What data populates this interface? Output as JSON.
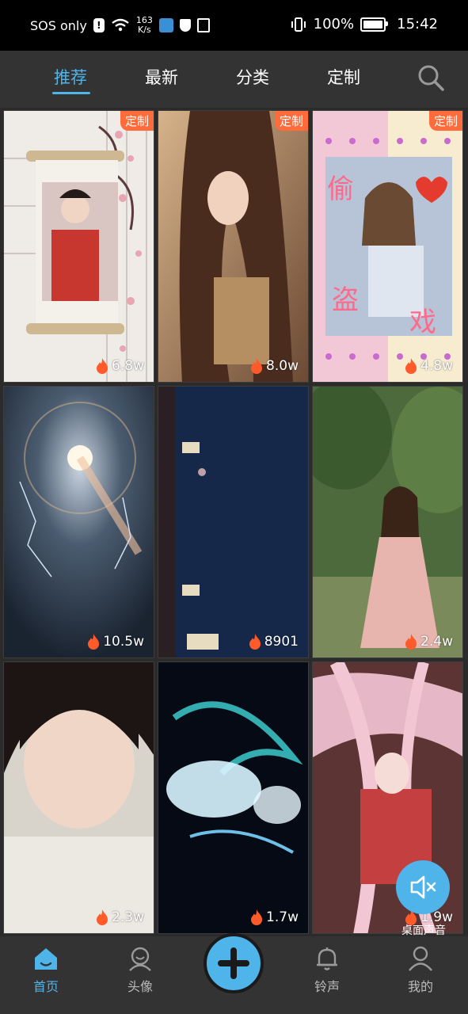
{
  "status_bar": {
    "carrier": "SOS only",
    "speed_value": "163",
    "speed_unit": "K/s",
    "battery": "100%",
    "time": "15:42"
  },
  "tabs": [
    "推荐",
    "最新",
    "分类",
    "定制"
  ],
  "active_tab": "推荐",
  "cards": [
    {
      "badge": "定制",
      "count": "6.8w",
      "theme": "scroll-hanfu"
    },
    {
      "badge": "定制",
      "count": "8.0w",
      "theme": "girl-sunlight"
    },
    {
      "badge": "定制",
      "count": "4.8w",
      "theme": "girl-stickers"
    },
    {
      "badge": "",
      "count": "10.5w",
      "theme": "cosmic-lightning"
    },
    {
      "badge": "",
      "count": "8901",
      "theme": "dark-door"
    },
    {
      "badge": "",
      "count": "2.4w",
      "theme": "girl-pink-dress"
    },
    {
      "badge": "",
      "count": "2.3w",
      "theme": "girl-bob"
    },
    {
      "badge": "",
      "count": "1.7w",
      "theme": "glow-anime"
    },
    {
      "badge": "",
      "count": "1.9w",
      "theme": "anime-pink-hair"
    }
  ],
  "sticker_text_1": "偷",
  "sticker_text_2": "盗",
  "sticker_text_3": "戏",
  "desktop_sound_label": "桌面声音",
  "bottom_nav": {
    "home": "首页",
    "avatar": "头像",
    "ringtone": "铃声",
    "mine": "我的"
  },
  "colors": {
    "accent": "#4fb4ea",
    "badge": "#ff6b3a",
    "flame": "#ff5a2a"
  }
}
